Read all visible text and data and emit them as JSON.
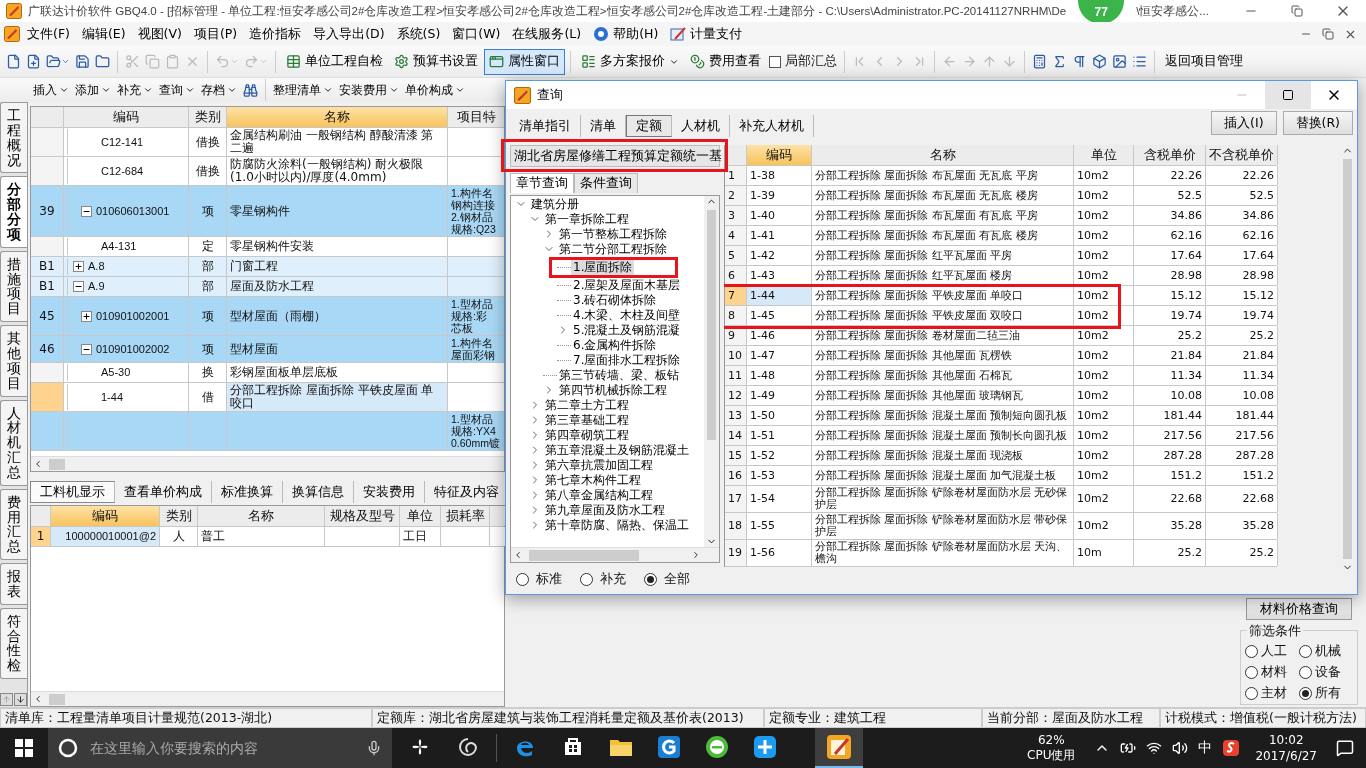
{
  "window": {
    "title": "广联达计价软件 GBQ4.0 - [招标管理 - 单位工程:恒安孝感公司2#仓库改造工程>恒安孝感公司2#仓库改造工程>恒安孝感公司2#仓库改造工程-土建部分 - C:\\Users\\Administrator.PC-20141127NRHM\\De",
    "title_tail": "\\恒安孝感公...",
    "badge": "77"
  },
  "menu": [
    "文件(F)",
    "编辑(E)",
    "视图(V)",
    "项目(P)",
    "造价指标",
    "导入导出(D)",
    "系统(S)",
    "窗口(W)",
    "在线服务(L)",
    "帮助(H)",
    "计量支付"
  ],
  "toolbar": [
    {
      "kind": "icon",
      "disabled": false
    },
    {
      "kind": "icon",
      "disabled": false
    },
    {
      "kind": "icon",
      "disabled": false,
      "dropdown": true
    },
    {
      "kind": "icon",
      "disabled": false
    },
    {
      "kind": "icon",
      "disabled": false
    },
    {
      "kind": "separator"
    },
    {
      "kind": "icon",
      "disabled": true
    },
    {
      "kind": "icon",
      "disabled": true
    },
    {
      "kind": "icon",
      "disabled": true
    },
    {
      "kind": "icon",
      "disabled": true
    },
    {
      "kind": "separator"
    },
    {
      "kind": "icon",
      "disabled": true,
      "dropdown": true
    },
    {
      "kind": "icon",
      "disabled": true,
      "dropdown": true
    },
    {
      "kind": "separator"
    },
    {
      "kind": "button",
      "label": "单位工程自检",
      "pressed": false
    },
    {
      "kind": "button",
      "label": "预算书设置",
      "pressed": false
    },
    {
      "kind": "button",
      "label": "属性窗口",
      "pressed": true
    },
    {
      "kind": "separator"
    },
    {
      "kind": "button",
      "label": "多方案报价",
      "pressed": false,
      "dropdown": true
    },
    {
      "kind": "button",
      "label": "费用查看",
      "pressed": false
    },
    {
      "kind": "checkbox",
      "label": "局部汇总",
      "checked": false
    },
    {
      "kind": "separator"
    },
    {
      "kind": "icon",
      "disabled": true
    },
    {
      "kind": "icon",
      "disabled": true
    },
    {
      "kind": "icon",
      "disabled": true
    },
    {
      "kind": "icon",
      "disabled": true
    },
    {
      "kind": "separator"
    },
    {
      "kind": "icon",
      "disabled": true
    },
    {
      "kind": "icon",
      "disabled": true
    },
    {
      "kind": "icon",
      "disabled": true
    },
    {
      "kind": "icon",
      "disabled": true
    },
    {
      "kind": "separator"
    },
    {
      "kind": "icon",
      "disabled": false
    },
    {
      "kind": "icon",
      "disabled": false
    },
    {
      "kind": "icon",
      "disabled": false
    },
    {
      "kind": "icon",
      "disabled": false
    },
    {
      "kind": "icon",
      "disabled": false
    },
    {
      "kind": "icon",
      "disabled": false
    },
    {
      "kind": "separator"
    },
    {
      "kind": "button",
      "label": "返回项目管理",
      "pressed": false
    }
  ],
  "edit_toolbar": [
    {
      "kind": "button",
      "label": "插入"
    },
    {
      "kind": "button",
      "label": "添加"
    },
    {
      "kind": "button",
      "label": "补充"
    },
    {
      "kind": "button",
      "label": "查询"
    },
    {
      "kind": "button",
      "label": "存档"
    },
    {
      "kind": "icon"
    },
    {
      "kind": "separator"
    },
    {
      "kind": "button",
      "label": "整理清单"
    },
    {
      "kind": "button",
      "label": "安装费用"
    },
    {
      "kind": "button",
      "label": "单价构成"
    }
  ],
  "side_tabs": [
    {
      "label": "工程概况",
      "selected": false
    },
    {
      "label": "分部分项",
      "selected": true
    },
    {
      "label": "措施项目",
      "selected": false
    },
    {
      "label": "其他项目",
      "selected": false
    },
    {
      "label": "人材机汇总",
      "selected": false
    },
    {
      "label": "费用汇总",
      "selected": false
    },
    {
      "label": "报表",
      "selected": false
    },
    {
      "label": "符合性检",
      "selected": false
    }
  ],
  "grid": {
    "columns": [
      "编码",
      "类别",
      "名称",
      "项目特"
    ],
    "rows": [
      {
        "kind": "quota",
        "code": "C12-141",
        "type": "借换",
        "name": "金属结构刷油 一般钢结构 醇酸清漆 第二遍",
        "selected": false
      },
      {
        "kind": "quota",
        "code": "C12-684",
        "type": "借换",
        "name": "防腐防火涂料(一般钢结构) 耐火极限(1.0小时以内)/厚度(4.0mm)",
        "selected": false
      },
      {
        "kind": "item",
        "number": "39",
        "code": "010606013001",
        "expanded": true,
        "type": "项",
        "name": "零星钢构件",
        "feature": [
          "1.构件名",
          "钢构连接",
          "2.钢材品",
          "规格:Q23"
        ],
        "selected": false
      },
      {
        "kind": "quota",
        "code": "A4-131",
        "type": "定",
        "name": "零星钢构件安装",
        "selected": false
      },
      {
        "kind": "section",
        "number": "B1",
        "code": "A.8",
        "expanded": false,
        "type": "部",
        "name": "门窗工程",
        "selected": false
      },
      {
        "kind": "section",
        "number": "B1",
        "code": "A.9",
        "expanded": true,
        "type": "部",
        "name": "屋面及防水工程",
        "selected": false
      },
      {
        "kind": "item",
        "number": "45",
        "code": "010901002001",
        "expanded": false,
        "type": "项",
        "name": "型材屋面（雨棚）",
        "feature": [
          "1.型材品",
          "规格:彩",
          "芯板"
        ],
        "selected": false
      },
      {
        "kind": "item",
        "number": "46",
        "code": "010901002002",
        "expanded": true,
        "type": "项",
        "name": "型材屋面",
        "feature": [
          "1.构件名",
          "屋面彩钢"
        ],
        "selected": false
      },
      {
        "kind": "quota",
        "code": "A5-30",
        "type": "换",
        "name": "彩钢屋面板单层底板",
        "selected": false
      },
      {
        "kind": "quota",
        "code": "1-44",
        "type": "借",
        "name": "分部工程拆除 屋面拆除 平铁皮屋面 单咬口",
        "selected": true
      },
      {
        "kind": "item",
        "feature": [
          "1.型材品",
          "规格:YX4",
          "0.60mm镀"
        ],
        "selected": false
      }
    ]
  },
  "detail_tabs": [
    {
      "label": "工料机显示",
      "selected": true
    },
    {
      "label": "查看单价构成",
      "selected": false
    },
    {
      "label": "标准换算",
      "selected": false
    },
    {
      "label": "换算信息",
      "selected": false
    },
    {
      "label": "安装费用",
      "selected": false
    },
    {
      "label": "特征及内容",
      "selected": false
    }
  ],
  "detail_grid": {
    "columns": [
      "编码",
      "类别",
      "名称",
      "规格及型号",
      "单位",
      "损耗率"
    ],
    "rows": [
      {
        "number": "1",
        "code": "100000010001@2",
        "type": "人",
        "name": "普工",
        "unit": "工日",
        "selected": true
      }
    ]
  },
  "price_panel": {
    "button": "材料价格查询",
    "filter_title": "筛选条件",
    "filters": [
      {
        "label": "人工",
        "selected": false
      },
      {
        "label": "机械",
        "selected": false
      },
      {
        "label": "材料",
        "selected": false
      },
      {
        "label": "设备",
        "selected": false
      },
      {
        "label": "主材",
        "selected": false
      },
      {
        "label": "所有",
        "selected": true
      }
    ]
  },
  "status_bar": [
    "清单库：工程量清单项目计量规范(2013-湖北)",
    "定额库：湖北省房屋建筑与装饰工程消耗量定额及基价表(2013)",
    "定额专业：建筑工程",
    "当前分部：屋面及防水工程",
    "计税模式：增值税(一般计税方法)"
  ],
  "dialog": {
    "title": "查询",
    "tabs": [
      {
        "label": "清单指引",
        "selected": false
      },
      {
        "label": "清单",
        "selected": false
      },
      {
        "label": "定额",
        "selected": true
      },
      {
        "label": "人材机",
        "selected": false
      },
      {
        "label": "补充人材机",
        "selected": false
      }
    ],
    "actions": [
      "插入(I)",
      "替换(R)"
    ],
    "library": {
      "value": "湖北省房屋修缮工程预算定额统一基",
      "highlighted": true
    },
    "search_tabs": [
      {
        "label": "章节查询",
        "selected": true
      },
      {
        "label": "条件查询",
        "selected": false
      }
    ],
    "tree": [
      {
        "label": "建筑分册",
        "expanded": true,
        "children": [
          {
            "label": "第一章拆除工程",
            "expanded": true,
            "children": [
              {
                "label": "第一节整栋工程拆除",
                "expanded": false
              },
              {
                "label": "第二节分部工程拆除",
                "expanded": true,
                "children": [
                  {
                    "label": "1.屋面拆除",
                    "selected": true,
                    "highlighted": true
                  },
                  {
                    "label": "2.屋架及屋面木基层",
                    "selected": false
                  },
                  {
                    "label": "3.砖石砌体拆除",
                    "selected": false
                  },
                  {
                    "label": "4.木梁、木柱及间壁",
                    "selected": false
                  },
                  {
                    "label": "5.混凝土及钢筋混凝",
                    "expanded": false
                  },
                  {
                    "label": "6.金属构件拆除",
                    "selected": false
                  },
                  {
                    "label": "7.屋面排水工程拆除",
                    "selected": false
                  }
                ]
              },
              {
                "label": "第三节砖墙、梁、板钻",
                "selected": false
              },
              {
                "label": "第四节机械拆除工程",
                "expanded": false
              }
            ]
          },
          {
            "label": "第二章土方工程",
            "expanded": false
          },
          {
            "label": "第三章基础工程",
            "expanded": false
          },
          {
            "label": "第四章砌筑工程",
            "expanded": false
          },
          {
            "label": "第五章混凝土及钢筋混凝土",
            "expanded": false
          },
          {
            "label": "第六章抗震加固工程",
            "expanded": false
          },
          {
            "label": "第七章木构件工程",
            "expanded": false
          },
          {
            "label": "第八章金属结构工程",
            "expanded": false
          },
          {
            "label": "第九章屋面及防水工程",
            "expanded": false
          },
          {
            "label": "第十章防腐、隔热、保温工",
            "expanded": false
          }
        ]
      }
    ],
    "scope": [
      {
        "label": "标准",
        "selected": false
      },
      {
        "label": "补充",
        "selected": false
      },
      {
        "label": "全部",
        "selected": true
      }
    ],
    "table": {
      "columns": [
        "编码",
        "名称",
        "单位",
        "含税单价",
        "不含税单价"
      ],
      "rows": [
        {
          "number": "1",
          "code": "1-38",
          "name": "分部工程拆除 屋面拆除 布瓦屋面 无瓦底 平房",
          "unit": "10m2",
          "price_tax": "22.26",
          "price": "22.26",
          "selected": false,
          "highlighted": false
        },
        {
          "number": "2",
          "code": "1-39",
          "name": "分部工程拆除 屋面拆除 布瓦屋面 无瓦底 楼房",
          "unit": "10m2",
          "price_tax": "52.5",
          "price": "52.5",
          "selected": false,
          "highlighted": false
        },
        {
          "number": "3",
          "code": "1-40",
          "name": "分部工程拆除 屋面拆除 布瓦屋面 有瓦底 平房",
          "unit": "10m2",
          "price_tax": "34.86",
          "price": "34.86",
          "selected": false,
          "highlighted": false
        },
        {
          "number": "4",
          "code": "1-41",
          "name": "分部工程拆除 屋面拆除 布瓦屋面 有瓦底 楼房",
          "unit": "10m2",
          "price_tax": "62.16",
          "price": "62.16",
          "selected": false,
          "highlighted": false
        },
        {
          "number": "5",
          "code": "1-42",
          "name": "分部工程拆除 屋面拆除 红平瓦屋面 平房",
          "unit": "10m2",
          "price_tax": "17.64",
          "price": "17.64",
          "selected": false,
          "highlighted": false
        },
        {
          "number": "6",
          "code": "1-43",
          "name": "分部工程拆除 屋面拆除 红平瓦屋面 楼房",
          "unit": "10m2",
          "price_tax": "28.98",
          "price": "28.98",
          "selected": false,
          "highlighted": false
        },
        {
          "number": "7",
          "code": "1-44",
          "name": "分部工程拆除 屋面拆除 平铁皮屋面 单咬口",
          "unit": "10m2",
          "price_tax": "15.12",
          "price": "15.12",
          "selected": true,
          "highlighted": true
        },
        {
          "number": "8",
          "code": "1-45",
          "name": "分部工程拆除 屋面拆除 平铁皮屋面 双咬口",
          "unit": "10m2",
          "price_tax": "19.74",
          "price": "19.74",
          "selected": false,
          "highlighted": true
        },
        {
          "number": "9",
          "code": "1-46",
          "name": "分部工程拆除 屋面拆除 卷材屋面二毡三油",
          "unit": "10m2",
          "price_tax": "25.2",
          "price": "25.2",
          "selected": false,
          "highlighted": false
        },
        {
          "number": "10",
          "code": "1-47",
          "name": "分部工程拆除 屋面拆除 其他屋面 瓦楞铁",
          "unit": "10m2",
          "price_tax": "21.84",
          "price": "21.84",
          "selected": false,
          "highlighted": false
        },
        {
          "number": "11",
          "code": "1-48",
          "name": "分部工程拆除 屋面拆除 其他屋面 石棉瓦",
          "unit": "10m2",
          "price_tax": "11.34",
          "price": "11.34",
          "selected": false,
          "highlighted": false
        },
        {
          "number": "12",
          "code": "1-49",
          "name": "分部工程拆除 屋面拆除 其他屋面 玻璃钢瓦",
          "unit": "10m2",
          "price_tax": "10.08",
          "price": "10.08",
          "selected": false,
          "highlighted": false
        },
        {
          "number": "13",
          "code": "1-50",
          "name": "分部工程拆除 屋面拆除 混凝土屋面 预制短向圆孔板",
          "unit": "10m2",
          "price_tax": "181.44",
          "price": "181.44",
          "selected": false,
          "highlighted": false
        },
        {
          "number": "14",
          "code": "1-51",
          "name": "分部工程拆除 屋面拆除 混凝土屋面 预制长向圆孔板",
          "unit": "10m2",
          "price_tax": "217.56",
          "price": "217.56",
          "selected": false,
          "highlighted": false
        },
        {
          "number": "15",
          "code": "1-52",
          "name": "分部工程拆除 屋面拆除 混凝土屋面 现浇板",
          "unit": "10m2",
          "price_tax": "287.28",
          "price": "287.28",
          "selected": false,
          "highlighted": false
        },
        {
          "number": "16",
          "code": "1-53",
          "name": "分部工程拆除 屋面拆除 混凝土屋面 加气混凝土板",
          "unit": "10m2",
          "price_tax": "151.2",
          "price": "151.2",
          "selected": false,
          "highlighted": false
        },
        {
          "number": "17",
          "code": "1-54",
          "name": "分部工程拆除 屋面拆除 铲除卷材屋面防水层 无砂保护层",
          "unit": "10m2",
          "price_tax": "22.68",
          "price": "22.68",
          "selected": false,
          "highlighted": false
        },
        {
          "number": "18",
          "code": "1-55",
          "name": "分部工程拆除 屋面拆除 铲除卷材屋面防水层 带砂保护层",
          "unit": "10m2",
          "price_tax": "35.28",
          "price": "35.28",
          "selected": false,
          "highlighted": false
        },
        {
          "number": "19",
          "code": "1-56",
          "name": "分部工程拆除 屋面拆除 铲除卷材屋面防水层 天沟、檐沟",
          "unit": "10m",
          "price_tax": "25.2",
          "price": "25.2",
          "selected": false,
          "highlighted": false
        }
      ]
    }
  },
  "taskbar": {
    "search_placeholder": "在这里输入你要搜索的内容",
    "cpu": "62%",
    "cpu_label": "CPU使用",
    "ime": "中",
    "time": "10:02",
    "date": "2017/6/27"
  }
}
